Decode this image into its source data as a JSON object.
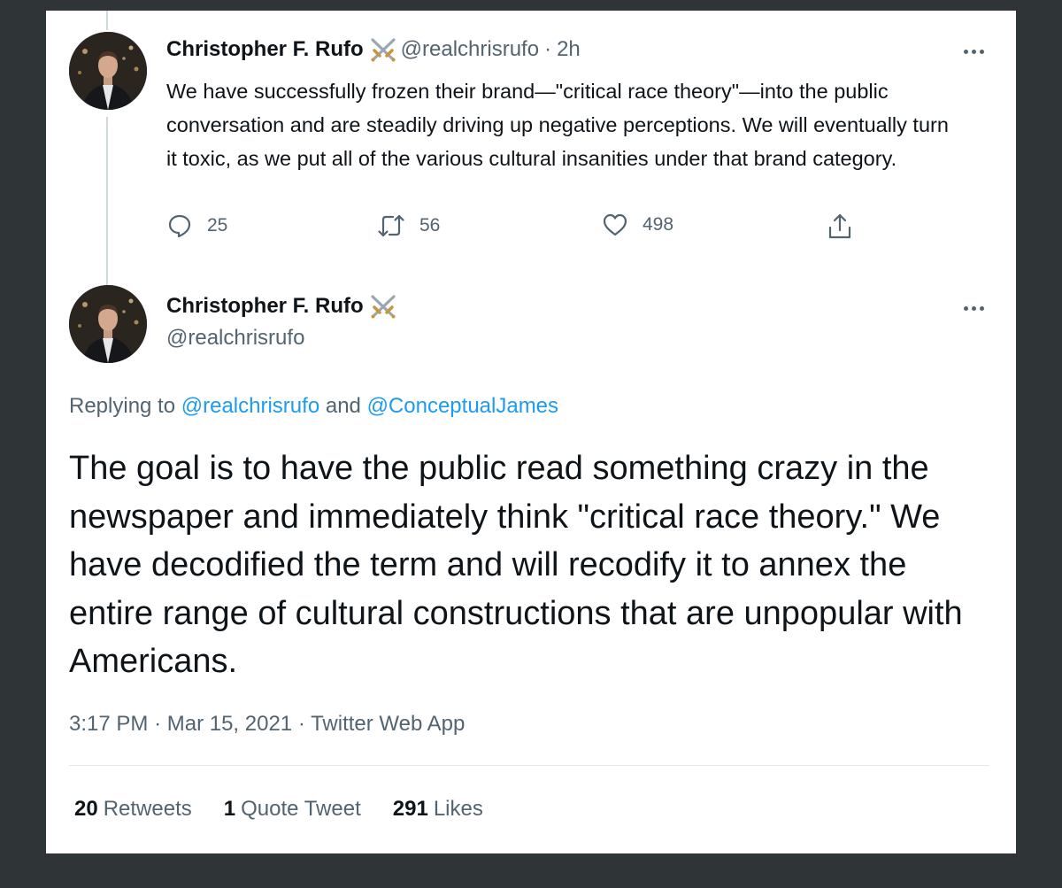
{
  "tweet1": {
    "display_name": "Christopher F. Rufo",
    "badge_icon": "crossed-swords-icon",
    "handle": "@realchrisrufo",
    "separator": "·",
    "time": "2h",
    "text": "We have successfully frozen their brand—\"critical race theory\"—into the public conversation and are steadily driving up negative perceptions. We will eventually turn it toxic, as we put all of the various cultural insanities under that brand category.",
    "actions": {
      "replies": "25",
      "retweets": "56",
      "likes": "498"
    }
  },
  "tweet2": {
    "display_name": "Christopher F. Rufo",
    "badge_icon": "crossed-swords-icon",
    "handle": "@realchrisrufo",
    "replying": {
      "prefix": "Replying to",
      "user1": "@realchrisrufo",
      "conj": "and",
      "user2": "@ConceptualJames"
    },
    "text": "The goal is to have the public read something crazy in the newspaper and immediately think \"critical race theory.\" We have decodified the term and will recodify it to annex the entire range of cultural constructions that are unpopular with Americans.",
    "meta": {
      "time": "3:17 PM",
      "sep": "·",
      "date": "Mar 15, 2021",
      "app": "Twitter Web App"
    },
    "stats": {
      "retweets_count": "20",
      "retweets_label": "Retweets",
      "quotes_count": "1",
      "quotes_label": "Quote Tweet",
      "likes_count": "291",
      "likes_label": "Likes"
    }
  },
  "colors": {
    "background": "#2f3437",
    "card": "#ffffff",
    "link": "#1d9bf0",
    "muted": "#536471"
  }
}
